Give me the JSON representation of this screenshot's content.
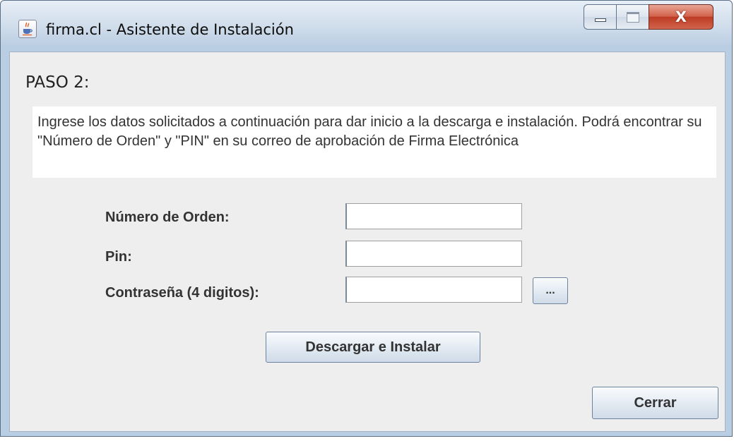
{
  "window": {
    "title": "firma.cl - Asistente de Instalación",
    "icon": "java-cup-icon",
    "controls": [
      "minimize-icon",
      "maximize-icon",
      "close-icon"
    ],
    "close_glyph": "X"
  },
  "step": "PASO  2:",
  "instructions": "Ingrese los datos solicitados a continuación para dar inicio a la descarga e instalación. Podrá encontrar su \"Número de Orden\" y \"PIN\" en su correo de aprobación de Firma Electrónica",
  "form": {
    "order_label": "Número de Orden:",
    "order_value": "",
    "pin_label": "Pin:",
    "pin_value": "",
    "password_label": "Contraseña (4 digitos):",
    "password_value": "",
    "browse_label": "..."
  },
  "actions": {
    "download_install": "Descargar e Instalar",
    "close": "Cerrar"
  },
  "colors": {
    "titlebar": "#c8d8ea",
    "client_bg": "#eeeeee",
    "close_button": "#c8472f"
  }
}
